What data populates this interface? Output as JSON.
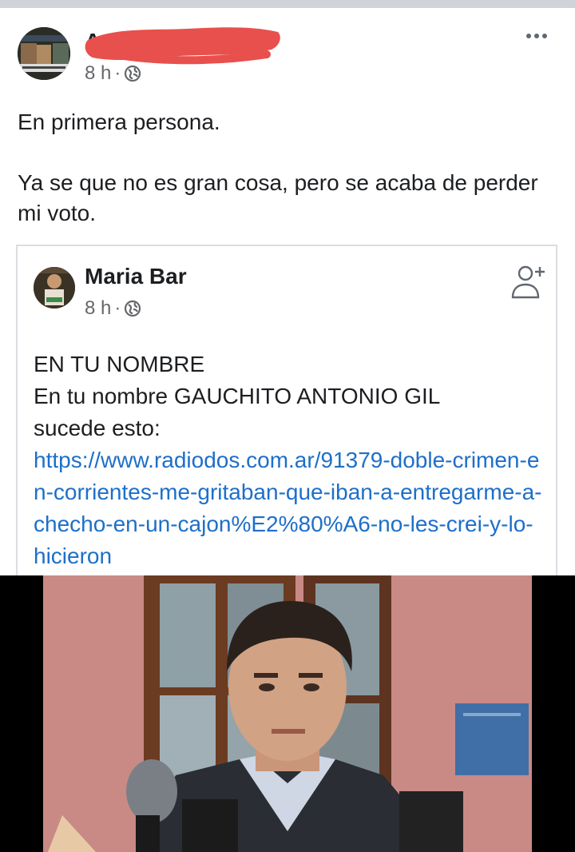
{
  "post": {
    "author_name": "A",
    "time": "8 h",
    "separator": "·",
    "globe_icon": "globe-icon",
    "more_icon": "more-horizontal-icon",
    "text_line1": "En primera persona.",
    "text_line2": "Ya se que no es gran cosa, pero se acaba de perder mi voto."
  },
  "shared_post": {
    "author_name": "Maria Bar",
    "time": "8 h",
    "separator": "·",
    "add_friend_icon": "add-friend-icon",
    "line1": "EN TU NOMBRE",
    "line2": "En tu nombre GAUCHITO ANTONIO GIL",
    "line3": "sucede esto:",
    "link": "https://www.radiodos.com.ar/91379-doble-crimen-en-corrientes-me-gritaban-que-iban-a-entregarme-a-checho-en-un-cajon%E2%80%A6-no-les-crei-y-lo-hicieron"
  },
  "colors": {
    "link": "#1d6fc9",
    "meta": "#65676b",
    "redaction": "#e8504d"
  }
}
